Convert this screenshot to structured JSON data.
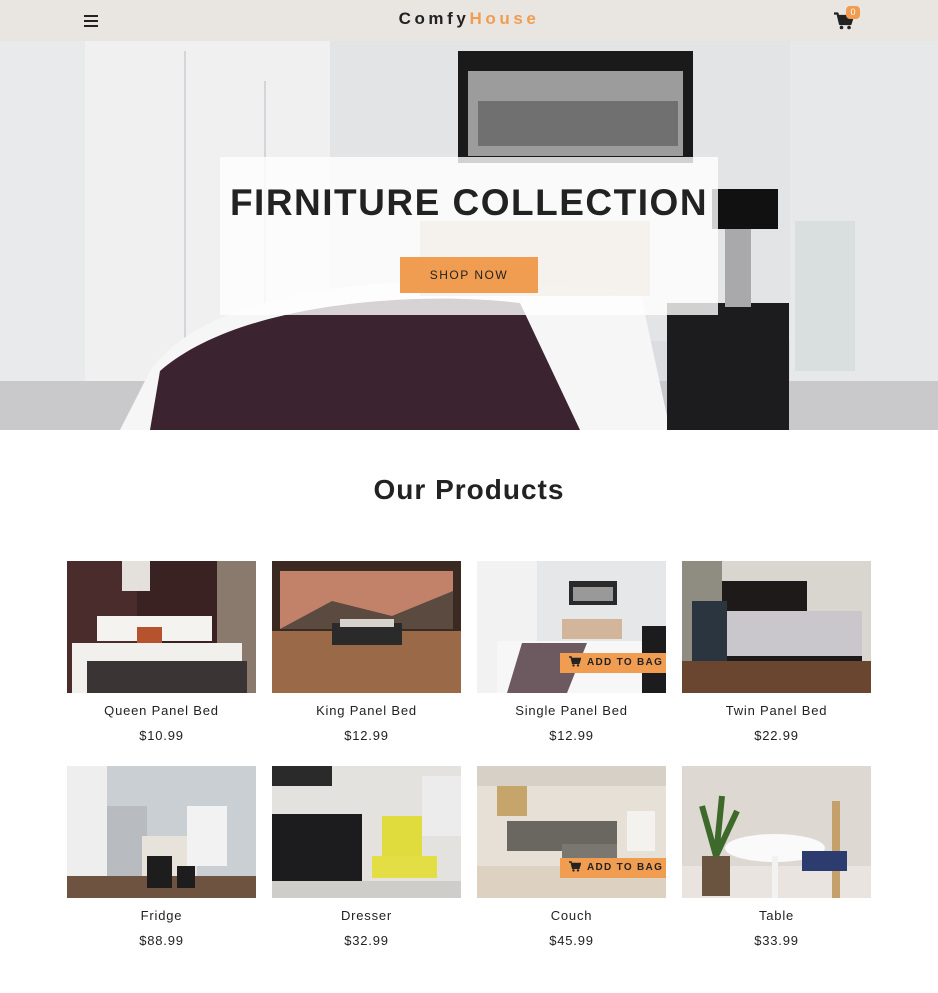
{
  "navbar": {
    "logo_part1": "Comfy",
    "logo_part2": "House",
    "cart_count": "0",
    "menu_icon": "hamburger-menu-icon",
    "cart_icon": "shopping-cart-icon"
  },
  "hero": {
    "title": "FIRNITURE COLLECTION",
    "button_label": "SHOP NOW"
  },
  "products_section": {
    "title": "Our Products",
    "add_to_bag_label": "ADD TO BAG",
    "items": [
      {
        "name": "Queen Panel Bed",
        "price": "$10.99"
      },
      {
        "name": "King Panel Bed",
        "price": "$12.99"
      },
      {
        "name": "Single Panel Bed",
        "price": "$12.99"
      },
      {
        "name": "Twin Panel Bed",
        "price": "$22.99"
      },
      {
        "name": "Fridge",
        "price": "$88.99"
      },
      {
        "name": "Dresser",
        "price": "$32.99"
      },
      {
        "name": "Couch",
        "price": "$45.99"
      },
      {
        "name": "Table",
        "price": "$33.99"
      }
    ]
  },
  "colors": {
    "accent": "#f09d51",
    "navbar_bg": "#e9e5e1",
    "text": "#222222"
  }
}
